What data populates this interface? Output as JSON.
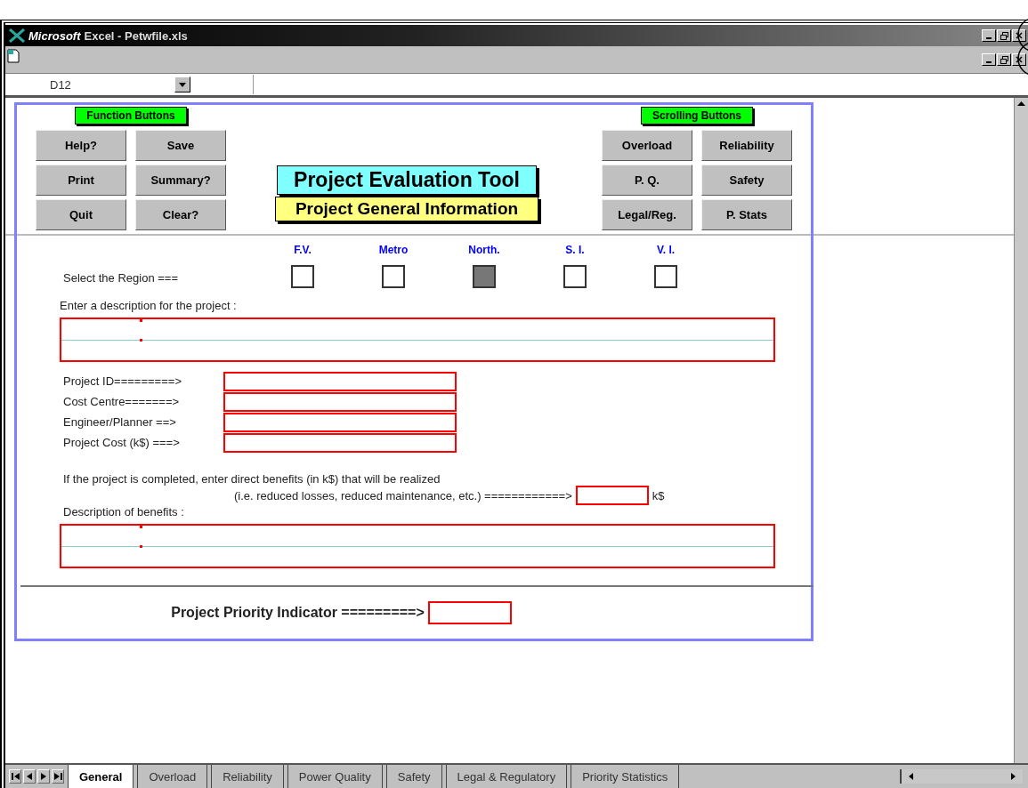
{
  "window": {
    "brand": "Microsoft",
    "title": "Excel - Petwfile.xls"
  },
  "formula_bar": {
    "name_box": "D12"
  },
  "function_buttons": {
    "label": "Function Buttons",
    "buttons": [
      "Help?",
      "Save",
      "Print",
      "Summary?",
      "Quit",
      "Clear?"
    ]
  },
  "heading": {
    "title": "Project Evaluation Tool",
    "subtitle": "Project General Information"
  },
  "scrolling_buttons": {
    "label": "Scrolling Buttons",
    "buttons": [
      "Overload",
      "Reliability",
      "P. Q.",
      "Safety",
      "Legal/Reg.",
      "P. Stats"
    ]
  },
  "region": {
    "label": "Select the Region ===",
    "options": [
      {
        "label": "F.V.",
        "checked": false
      },
      {
        "label": "Metro",
        "checked": false
      },
      {
        "label": "North.",
        "checked": true
      },
      {
        "label": "S. I.",
        "checked": false
      },
      {
        "label": "V. I.",
        "checked": false
      }
    ]
  },
  "description_label": "Enter a description for the project :",
  "fields": [
    {
      "label": "Project ID=========>"
    },
    {
      "label": "Cost Centre=======>"
    },
    {
      "label": "Engineer/Planner ==>"
    },
    {
      "label": "Project Cost (k$) ===>"
    }
  ],
  "benefits": {
    "line_1": "If the project is completed, enter direct benefits (in k$) that will be realized",
    "line_2": "(i.e. reduced losses, reduced maintenance, etc.) ============>",
    "unit": "k$",
    "description_label": "Description of benefits :"
  },
  "priority": {
    "label": "Project Priority Indicator =========>"
  },
  "sheet_tabs": [
    {
      "label": "General",
      "selected": true
    },
    {
      "label": "Overload",
      "selected": false
    },
    {
      "label": "Reliability",
      "selected": false
    },
    {
      "label": "Power Quality",
      "selected": false
    },
    {
      "label": "Safety",
      "selected": false
    },
    {
      "label": "Legal & Regulatory",
      "selected": false
    },
    {
      "label": "Priority Statistics",
      "selected": false
    }
  ]
}
